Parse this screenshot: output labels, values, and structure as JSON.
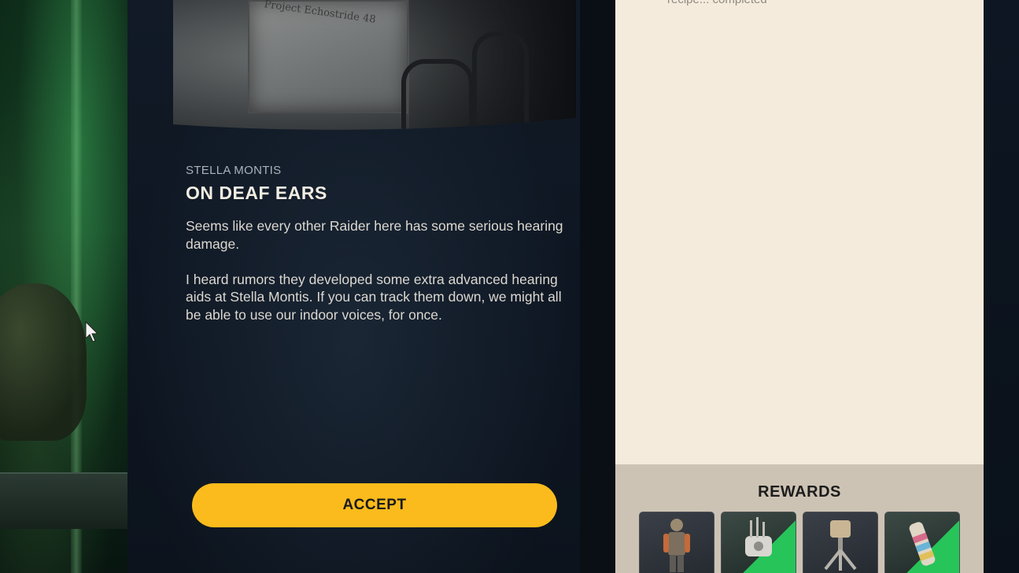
{
  "mission": {
    "location": "STELLA MONTIS",
    "title": "ON DEAF EARS",
    "description": [
      "Seems like every other Raider here has some serious hearing damage.",
      "I heard rumors they developed some extra advanced hearing aids at Stella Montis. If you can track them down, we might all be able to use our indoor voices, for once."
    ],
    "hero_sign_text": "Project Echostride 48"
  },
  "actions": {
    "accept_label": "ACCEPT"
  },
  "objectives": {
    "partial_text": "recipe... completed"
  },
  "rewards": {
    "title": "REWARDS",
    "items": [
      {
        "icon": "raider-outfit-icon",
        "rarity": "common"
      },
      {
        "icon": "turret-gadget-icon",
        "rarity": "uncommon"
      },
      {
        "icon": "tripod-device-icon",
        "rarity": "common"
      },
      {
        "icon": "canister-icon",
        "rarity": "uncommon"
      }
    ]
  },
  "colors": {
    "accept_button": "#fbbb1c",
    "panel_dark": "#0e1622",
    "parchment": "#f5ebdc",
    "rewards_bg": "#cdc3b4",
    "uncommon_green": "#27c45a"
  }
}
